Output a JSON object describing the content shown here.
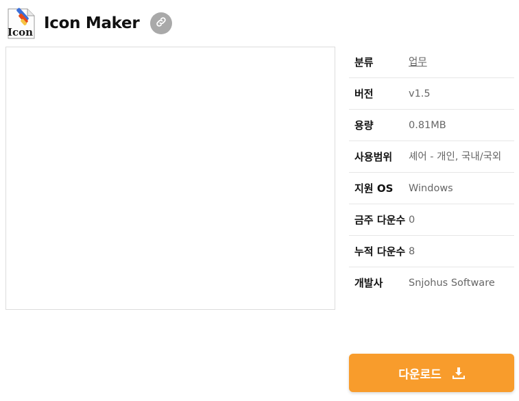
{
  "app": {
    "icon_name": "icon-maker-app-icon",
    "icon_text": "Icon",
    "title": "Icon Maker",
    "link_icon": "link-icon"
  },
  "info": [
    {
      "key": "category",
      "label": "분류",
      "value": "업무",
      "is_link": true
    },
    {
      "key": "version",
      "label": "버전",
      "value": "v1.5"
    },
    {
      "key": "size",
      "label": "용량",
      "value": "0.81MB"
    },
    {
      "key": "license",
      "label": "사용범위",
      "value": "셰어 - 개인, 국내/국외"
    },
    {
      "key": "os",
      "label": "지원 OS",
      "value": "Windows"
    },
    {
      "key": "weekly",
      "label": "금주 다운수",
      "value": "0"
    },
    {
      "key": "total",
      "label": "누적 다운수",
      "value": "8"
    },
    {
      "key": "developer",
      "label": "개발사",
      "value": "Snjohus Software"
    }
  ],
  "download": {
    "label": "다운로드",
    "icon": "download-icon",
    "color": "#f89c2c"
  }
}
